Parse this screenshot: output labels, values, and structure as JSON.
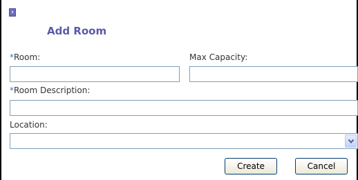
{
  "dialog": {
    "title": "Add Room"
  },
  "form": {
    "room": {
      "required_marker": "*",
      "label": "Room:",
      "value": ""
    },
    "max_capacity": {
      "label": "Max Capacity:",
      "value": ""
    },
    "room_description": {
      "required_marker": "*",
      "label": "Room Description:",
      "value": ""
    },
    "location": {
      "label": "Location:",
      "selected": ""
    }
  },
  "buttons": {
    "create": "Create",
    "cancel": "Cancel"
  },
  "colors": {
    "title": "#5a5aa8",
    "required_marker": "#3a6fd0",
    "input_border": "#7f9db9"
  }
}
